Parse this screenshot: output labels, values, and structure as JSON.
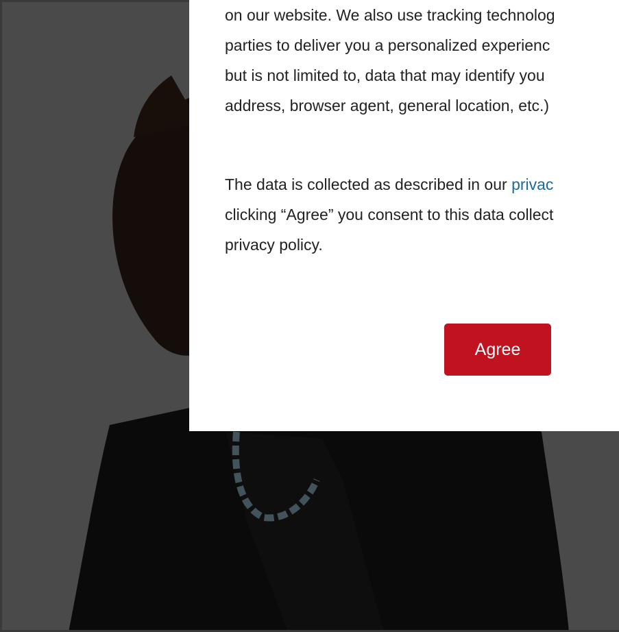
{
  "consent": {
    "paragraph1": {
      "lines": [
        "on our website. We also use tracking technolog",
        "parties to deliver you a personalized experienc",
        "but is not limited to, data that may identify you",
        "address, browser agent, general location, etc.)"
      ]
    },
    "paragraph2": {
      "line1_prefix": "The data is collected as described in our ",
      "link_text": "privac",
      "line2": "clicking “Agree” you consent to this data collect",
      "line3": "privacy policy."
    },
    "agree_label": "Agree"
  },
  "colors": {
    "agree_button": "#c0121f",
    "link": "#1a6b9e",
    "text": "#222222"
  }
}
